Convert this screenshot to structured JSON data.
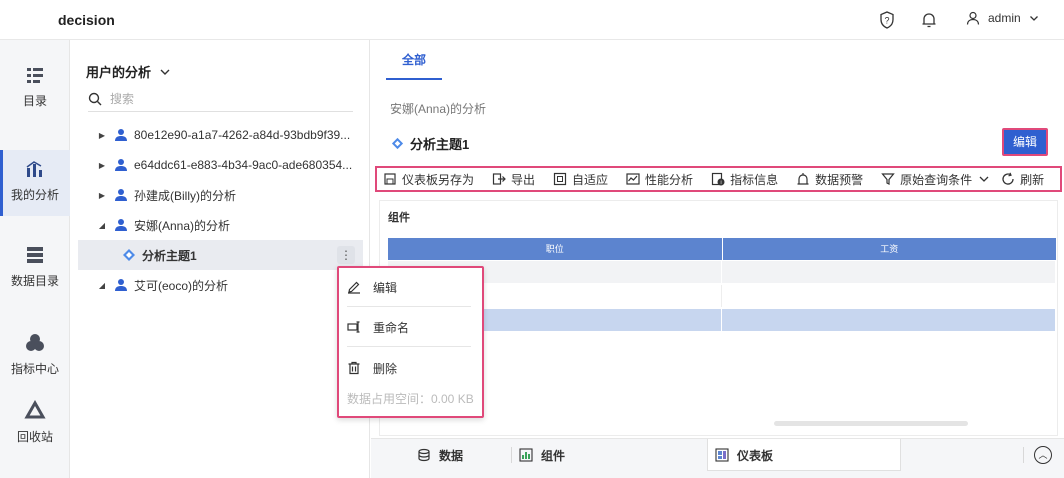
{
  "app": {
    "title": "decision",
    "user": "admin"
  },
  "nav": [
    {
      "label": "目录",
      "icon": "catalog-icon"
    },
    {
      "label": "我的分析",
      "icon": "analysis-icon"
    },
    {
      "label": "数据目录",
      "icon": "data-catalog-icon"
    },
    {
      "label": "指标中心",
      "icon": "metrics-center-icon"
    },
    {
      "label": "回收站",
      "icon": "recycle-icon"
    }
  ],
  "tree": {
    "title": "用户的分析",
    "search_placeholder": "搜索",
    "rows": [
      {
        "label": "80e12e90-a1a7-4262-a84d-93bdb9f39..."
      },
      {
        "label": "e64ddc61-e883-4b34-9ac0-ade680354..."
      },
      {
        "label": "孙建成(Billy)的分析"
      },
      {
        "label": "安娜(Anna)的分析"
      },
      {
        "label": "分析主题1"
      },
      {
        "label": "艾可(eoco)的分析"
      }
    ]
  },
  "context_menu": {
    "edit": "编辑",
    "rename": "重命名",
    "delete": "删除",
    "storage": "数据占用空间：0.00 KB"
  },
  "main": {
    "tab_all": "全部",
    "breadcrumb": "安娜(Anna)的分析",
    "theme_title": "分析主题1",
    "edit_button": "编辑",
    "toolbar": [
      "仪表板另存为",
      "导出",
      "自适应",
      "性能分析",
      "指标信息",
      "数据预警",
      "原始查询条件",
      "刷新"
    ],
    "widget_title": "组件",
    "columns": [
      "职位",
      "工资"
    ]
  },
  "bottom": {
    "data": "数据",
    "widget": "组件",
    "dashboard": "仪表板"
  },
  "colors": {
    "accent": "#2f5fd0",
    "highlight": "#e0497a",
    "table_header": "#5c84cf"
  }
}
